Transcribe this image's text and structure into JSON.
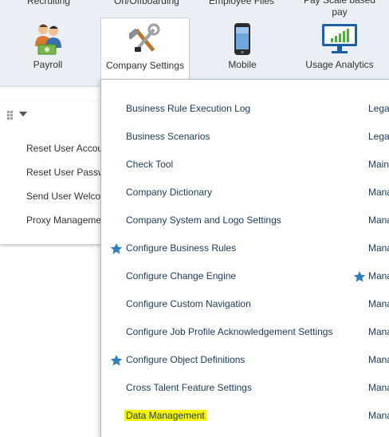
{
  "top_row_cut": [
    "Recruiting",
    "On/Offboarding",
    "Employee Files",
    "Pay Scale based pay"
  ],
  "tiles": [
    {
      "label": "Payroll",
      "icon": "payroll-people-icon"
    },
    {
      "label": "Company Settings",
      "icon": "tools-icon"
    },
    {
      "label": "Mobile",
      "icon": "mobile-phone-icon"
    },
    {
      "label": "Usage Analytics",
      "icon": "analytics-monitor-icon"
    }
  ],
  "left_panel": {
    "links": [
      "Reset User Accou",
      "Reset User Passw",
      "Send User Welco",
      "Proxy Manageme"
    ]
  },
  "dropdown": {
    "items": [
      "Business Rule Execution Log",
      "Business Scenarios",
      "Check Tool",
      "Company Dictionary",
      "Company System and Logo Settings",
      "Configure Business Rules",
      "Configure Change Engine",
      "Configure Custom Navigation",
      "Configure Job Profile Acknowledgement Settings",
      "Configure Object Definitions",
      "Cross Talent Feature Settings",
      "Data Management"
    ],
    "right_items": [
      "Lega",
      "Lega",
      "Main",
      "Mana",
      "Mana",
      "Mana",
      "Mana",
      "Mana",
      "Mana",
      "Mana",
      "Mana",
      "Mana"
    ],
    "favorite_items": [
      "Configure Business Rules",
      "Configure Object Definitions"
    ],
    "favorite_right": [
      "Mana"
    ],
    "highlighted": "Data Management",
    "colors": {
      "star": "#2f7fbf",
      "highlight": "#f5f500",
      "link": "#1a3b5a"
    }
  }
}
